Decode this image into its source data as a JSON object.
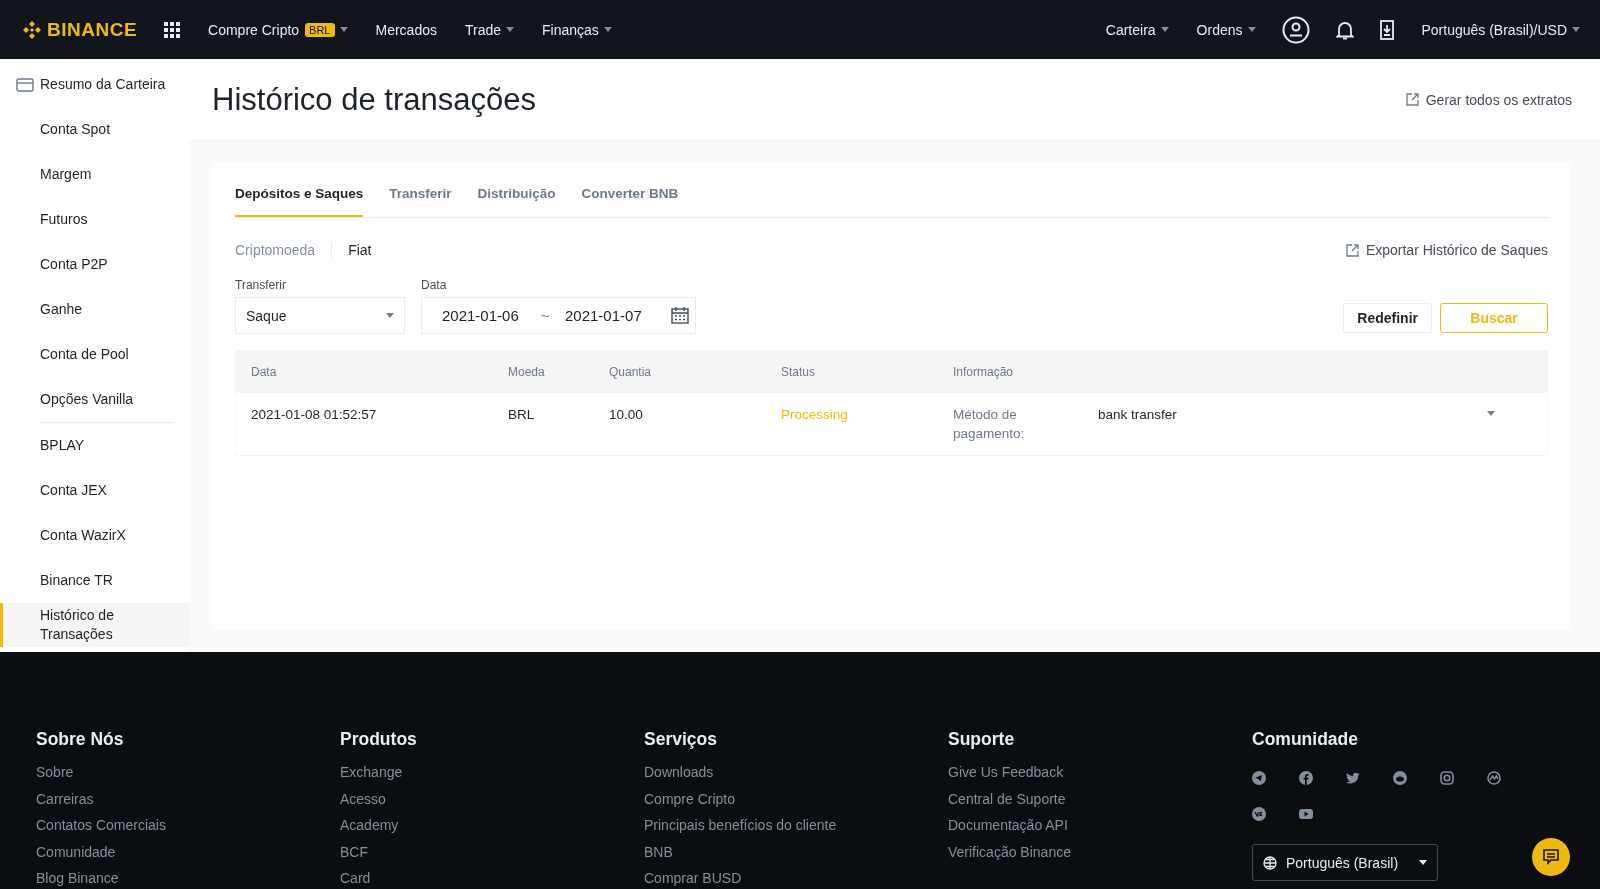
{
  "header": {
    "logo": "BINANCE",
    "nav": [
      {
        "label": "Compre Cripto",
        "badge": "BRL",
        "dropdown": true
      },
      {
        "label": "Mercados",
        "dropdown": false
      },
      {
        "label": "Trade",
        "dropdown": true
      },
      {
        "label": "Finanças",
        "dropdown": true
      }
    ],
    "right_nav": [
      {
        "label": "Carteira",
        "dropdown": true
      },
      {
        "label": "Ordens",
        "dropdown": true
      }
    ],
    "language": "Português (Brasil)/USD"
  },
  "sidebar": {
    "groups": [
      [
        {
          "label": "Resumo da Carteira",
          "kind": "overview",
          "selected": false
        },
        {
          "label": "Conta Spot",
          "kind": "account",
          "selected": false
        },
        {
          "label": "Margem",
          "kind": "account",
          "selected": false
        },
        {
          "label": "Futuros",
          "kind": "account",
          "selected": false
        },
        {
          "label": "Conta P2P",
          "kind": "account",
          "selected": false
        },
        {
          "label": "Ganhe",
          "kind": "account",
          "selected": false
        },
        {
          "label": "Conta de Pool",
          "kind": "account",
          "selected": false
        },
        {
          "label": "Opções Vanilla",
          "kind": "account",
          "selected": false
        }
      ],
      [
        {
          "label": "BPLAY",
          "kind": "account",
          "selected": false
        },
        {
          "label": "Conta JEX",
          "kind": "account",
          "selected": false
        },
        {
          "label": "Conta WazirX",
          "kind": "account",
          "selected": false
        },
        {
          "label": "Binance TR",
          "kind": "account",
          "selected": false
        },
        {
          "label": "Histórico de Transações",
          "kind": "account",
          "selected": true
        }
      ]
    ]
  },
  "page": {
    "title": "Histórico de transações",
    "statements_link": "Gerar todos os extratos"
  },
  "tabs": [
    {
      "label": "Depósitos e Saques",
      "selected": true
    },
    {
      "label": "Transferir",
      "selected": false
    },
    {
      "label": "Distribuição",
      "selected": false
    },
    {
      "label": "Converter BNB",
      "selected": false
    }
  ],
  "subtabs": [
    {
      "label": "Criptomoeda",
      "selected": false
    },
    {
      "label": "Fiat",
      "selected": true
    }
  ],
  "export_link": "Exportar Histórico de Saques",
  "filters": {
    "transfer": {
      "label": "Transferir",
      "value": "Saque"
    },
    "date": {
      "label": "Data",
      "start": "2021-01-06",
      "separator": "~",
      "end": "2021-01-07"
    }
  },
  "buttons": [
    {
      "label": "Redefinir",
      "kind": "default"
    },
    {
      "label": "Buscar",
      "kind": "primary"
    }
  ],
  "table": {
    "columns": [
      "Data",
      "Moeda",
      "Quantia",
      "Status",
      "Informação"
    ],
    "rows": [
      {
        "date": "2021-01-08 01:52:57",
        "coin": "BRL",
        "amount": "10.00",
        "status": "Processing",
        "color": "#f0b90b",
        "info_label": "Método de pagamento:",
        "info_value": "bank transfer",
        "expanded": false
      }
    ]
  },
  "footer": {
    "columns": [
      {
        "heading": "Sobre Nós",
        "links": [
          "Sobre",
          "Carreiras",
          "Contatos Comerciais",
          "Comunidade",
          "Blog Binance"
        ]
      },
      {
        "heading": "Produtos",
        "links": [
          "Exchange",
          "Acesso",
          "Academy",
          "BCF",
          "Card"
        ]
      },
      {
        "heading": "Serviços",
        "links": [
          "Downloads",
          "Compre Cripto",
          "Principais benefícios do cliente",
          "BNB",
          "Comprar BUSD"
        ]
      },
      {
        "heading": "Suporte",
        "links": [
          "Give Us Feedback",
          "Central de Suporte",
          "Documentação API",
          "Verificação Binance"
        ]
      }
    ],
    "community": {
      "heading": "Comunidade",
      "language": "Português (Brasil)"
    }
  }
}
